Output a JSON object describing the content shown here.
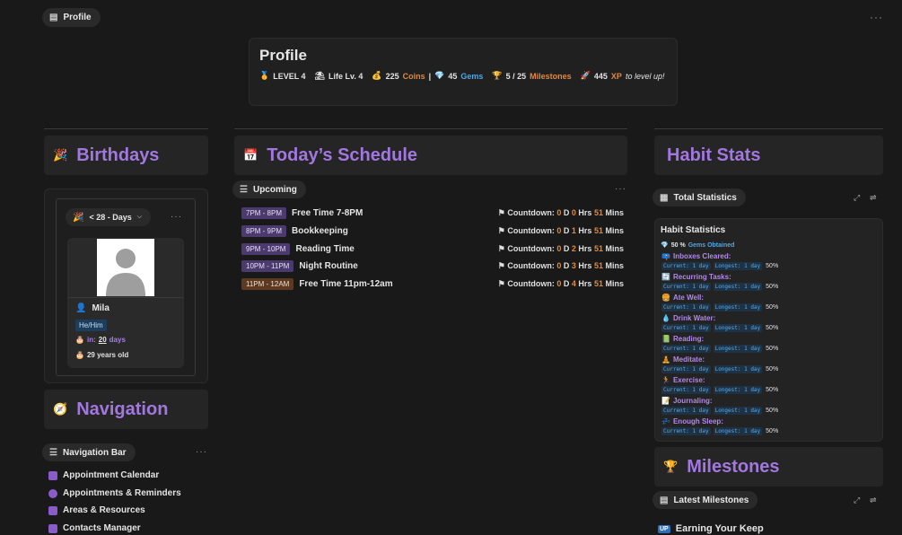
{
  "top": {
    "profile_pill": "Profile",
    "icon": "doc-icon"
  },
  "profile": {
    "title": "Profile",
    "level": "LEVEL 4",
    "life": "Life Lv. 4",
    "coins_num": "225",
    "coins_label": "Coins",
    "sep": "|",
    "gems_num": "45",
    "gems_label": "Gems",
    "milestones_num": "5 / 25",
    "milestones_label": "Milestones",
    "xp_num": "445",
    "xp_label": "XP",
    "xp_suffix": "to level up!"
  },
  "birthdays": {
    "title": "Birthdays",
    "filter": "< 28 - Days",
    "person_name": "Mila",
    "pronoun": "He/Him",
    "in_prefix": "in:",
    "in_days": "20",
    "in_suffix": "days",
    "age": "29 years old"
  },
  "schedule": {
    "title": "Today’s Schedule",
    "pill": "Upcoming",
    "items": [
      {
        "time": "7PM - 8PM",
        "name": "Free Time 7-8PM",
        "label": "Countdown:",
        "d": "0",
        "h": "0",
        "m": "51"
      },
      {
        "time": "8PM - 9PM",
        "name": "Bookkeeping",
        "label": "Countdown:",
        "d": "0",
        "h": "1",
        "m": "51"
      },
      {
        "time": "9PM - 10PM",
        "name": "Reading Time",
        "label": "Countdown:",
        "d": "0",
        "h": "2",
        "m": "51"
      },
      {
        "time": "10PM - 11PM",
        "name": "Night Routine",
        "label": "Countdown:",
        "d": "0",
        "h": "3",
        "m": "51"
      },
      {
        "time": "11PM - 12AM",
        "name": "Free Time 11pm-12am",
        "label": "Countdown:",
        "d": "0",
        "h": "4",
        "m": "51"
      }
    ],
    "d_unit": "D",
    "hrs_unit": "Hrs",
    "mins_unit": "Mins"
  },
  "habit": {
    "title": "Habit Stats",
    "pill": "Total Statistics",
    "card_title": "Habit Statistics",
    "gems_pct": "50 %",
    "gems_label": "Gems Obtained",
    "current": "Current: 1 day",
    "longest": "Longest: 1 day",
    "pct": "50%",
    "items": [
      {
        "emoji": "📪",
        "label": "Inboxes Cleared:"
      },
      {
        "emoji": "🔄",
        "label": "Recurring Tasks:"
      },
      {
        "emoji": "🍔",
        "label": "Ate Well:"
      },
      {
        "emoji": "💧",
        "label": "Drink Water:"
      },
      {
        "emoji": "📗",
        "label": "Reading:"
      },
      {
        "emoji": "🧘",
        "label": "Meditate:"
      },
      {
        "emoji": "🏃",
        "label": "Exercise:"
      },
      {
        "emoji": "📝",
        "label": "Journaling:"
      },
      {
        "emoji": "💤",
        "label": "Enough Sleep:"
      }
    ]
  },
  "milestones": {
    "title": "Milestones",
    "pill": "Latest Milestones",
    "first": "Earning Your Keep"
  },
  "navigation": {
    "title": "Navigation",
    "pill": "Navigation Bar",
    "items": [
      "Appointment Calendar",
      "Appointments & Reminders",
      "Areas & Resources",
      "Contacts Manager"
    ]
  }
}
